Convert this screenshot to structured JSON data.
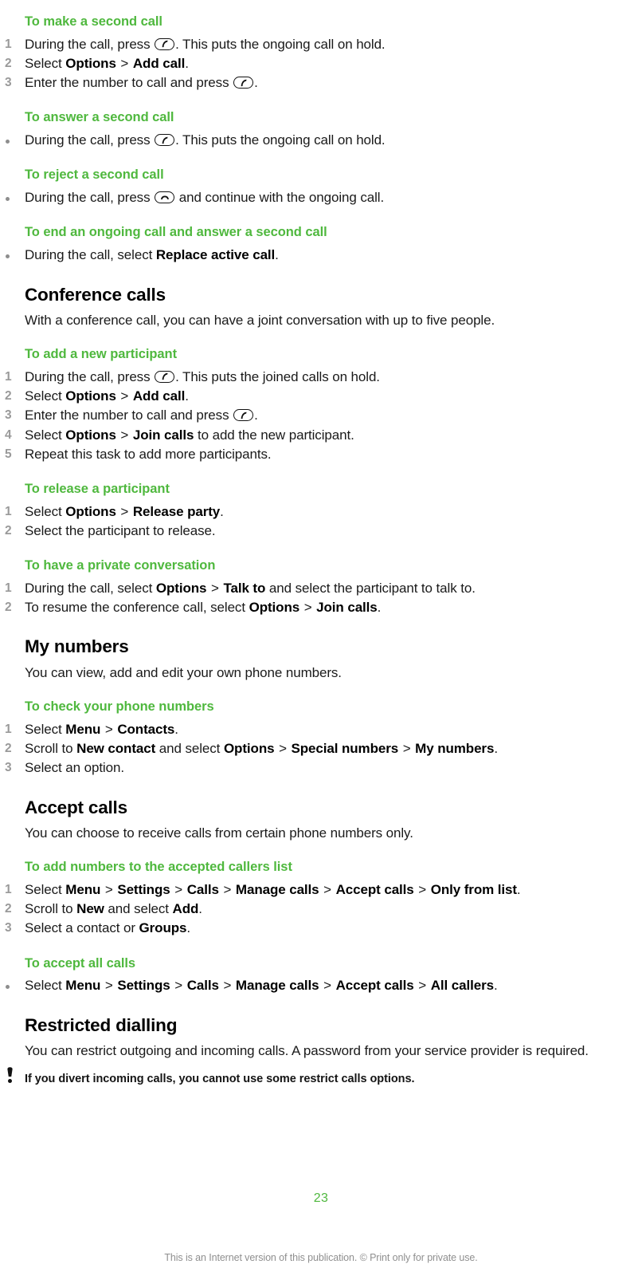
{
  "document": {
    "page_number": "23",
    "footer_note": "This is an Internet version of this publication. © Print only for private use.",
    "accent_green": "#4fb83e",
    "marker_gray": "#9a9a9a",
    "footer_gray": "#8f8f8f"
  },
  "blocks": [
    {
      "type": "task",
      "heading": "To make a second call",
      "list_style": "ordered",
      "items": [
        {
          "marker": "1",
          "segments": [
            {
              "t": "During the call, press "
            },
            {
              "icon": "call-key-icon"
            },
            {
              "t": ". This puts the ongoing call on hold."
            }
          ]
        },
        {
          "marker": "2",
          "segments": [
            {
              "t": "Select "
            },
            {
              "t": "Options",
              "bold": true
            },
            {
              "t": " > ",
              "gt": true
            },
            {
              "t": "Add call",
              "bold": true
            },
            {
              "t": "."
            }
          ]
        },
        {
          "marker": "3",
          "segments": [
            {
              "t": "Enter the number to call and press "
            },
            {
              "icon": "call-key-icon"
            },
            {
              "t": "."
            }
          ]
        }
      ]
    },
    {
      "type": "task",
      "heading": "To answer a second call",
      "list_style": "bullet",
      "items": [
        {
          "marker": "•",
          "segments": [
            {
              "t": "During the call, press "
            },
            {
              "icon": "call-key-icon"
            },
            {
              "t": ". This puts the ongoing call on hold."
            }
          ]
        }
      ]
    },
    {
      "type": "task",
      "heading": "To reject a second call",
      "list_style": "bullet",
      "items": [
        {
          "marker": "•",
          "segments": [
            {
              "t": "During the call, press "
            },
            {
              "icon": "end-call-key-icon"
            },
            {
              "t": " and continue with the ongoing call."
            }
          ]
        }
      ]
    },
    {
      "type": "task",
      "heading": "To end an ongoing call and answer a second call",
      "list_style": "bullet",
      "items": [
        {
          "marker": "•",
          "segments": [
            {
              "t": "During the call, select "
            },
            {
              "t": "Replace active call",
              "bold": true
            },
            {
              "t": "."
            }
          ]
        }
      ]
    },
    {
      "type": "section",
      "heading": "Conference calls",
      "paragraph": "With a conference call, you can have a joint conversation with up to five people."
    },
    {
      "type": "task",
      "heading": "To add a new participant",
      "list_style": "ordered",
      "items": [
        {
          "marker": "1",
          "segments": [
            {
              "t": "During the call, press "
            },
            {
              "icon": "call-key-icon"
            },
            {
              "t": ". This puts the joined calls on hold."
            }
          ]
        },
        {
          "marker": "2",
          "segments": [
            {
              "t": "Select "
            },
            {
              "t": "Options",
              "bold": true
            },
            {
              "t": " > ",
              "gt": true
            },
            {
              "t": "Add call",
              "bold": true
            },
            {
              "t": "."
            }
          ]
        },
        {
          "marker": "3",
          "segments": [
            {
              "t": "Enter the number to call and press "
            },
            {
              "icon": "call-key-icon"
            },
            {
              "t": "."
            }
          ]
        },
        {
          "marker": "4",
          "segments": [
            {
              "t": "Select "
            },
            {
              "t": "Options",
              "bold": true
            },
            {
              "t": " > ",
              "gt": true
            },
            {
              "t": "Join calls",
              "bold": true
            },
            {
              "t": " to add the new participant."
            }
          ]
        },
        {
          "marker": "5",
          "segments": [
            {
              "t": "Repeat this task to add more participants."
            }
          ]
        }
      ]
    },
    {
      "type": "task",
      "heading": "To release a participant",
      "list_style": "ordered",
      "items": [
        {
          "marker": "1",
          "segments": [
            {
              "t": "Select "
            },
            {
              "t": "Options",
              "bold": true
            },
            {
              "t": " > ",
              "gt": true
            },
            {
              "t": "Release party",
              "bold": true
            },
            {
              "t": "."
            }
          ]
        },
        {
          "marker": "2",
          "segments": [
            {
              "t": "Select the participant to release."
            }
          ]
        }
      ]
    },
    {
      "type": "task",
      "heading": "To have a private conversation",
      "list_style": "ordered",
      "items": [
        {
          "marker": "1",
          "segments": [
            {
              "t": "During the call, select "
            },
            {
              "t": "Options",
              "bold": true
            },
            {
              "t": " > ",
              "gt": true
            },
            {
              "t": "Talk to",
              "bold": true
            },
            {
              "t": " and select the participant to talk to."
            }
          ]
        },
        {
          "marker": "2",
          "segments": [
            {
              "t": "To resume the conference call, select "
            },
            {
              "t": "Options",
              "bold": true
            },
            {
              "t": " > ",
              "gt": true
            },
            {
              "t": "Join calls",
              "bold": true
            },
            {
              "t": "."
            }
          ]
        }
      ]
    },
    {
      "type": "section",
      "heading": "My numbers",
      "paragraph": "You can view, add and edit your own phone numbers."
    },
    {
      "type": "task",
      "heading": "To check your phone numbers",
      "list_style": "ordered",
      "items": [
        {
          "marker": "1",
          "segments": [
            {
              "t": "Select "
            },
            {
              "t": "Menu",
              "bold": true
            },
            {
              "t": " > ",
              "gt": true
            },
            {
              "t": "Contacts",
              "bold": true
            },
            {
              "t": "."
            }
          ]
        },
        {
          "marker": "2",
          "segments": [
            {
              "t": "Scroll to "
            },
            {
              "t": "New contact",
              "bold": true
            },
            {
              "t": " and select "
            },
            {
              "t": "Options",
              "bold": true
            },
            {
              "t": " > ",
              "gt": true
            },
            {
              "t": "Special numbers",
              "bold": true
            },
            {
              "t": " > ",
              "gt": true
            },
            {
              "t": "My numbers",
              "bold": true
            },
            {
              "t": "."
            }
          ]
        },
        {
          "marker": "3",
          "segments": [
            {
              "t": "Select an option."
            }
          ]
        }
      ]
    },
    {
      "type": "section",
      "heading": "Accept calls",
      "paragraph": "You can choose to receive calls from certain phone numbers only."
    },
    {
      "type": "task",
      "heading": "To add numbers to the accepted callers list",
      "list_style": "ordered",
      "items": [
        {
          "marker": "1",
          "segments": [
            {
              "t": "Select "
            },
            {
              "t": "Menu",
              "bold": true
            },
            {
              "t": " > ",
              "gt": true
            },
            {
              "t": "Settings",
              "bold": true
            },
            {
              "t": " > ",
              "gt": true
            },
            {
              "t": "Calls",
              "bold": true
            },
            {
              "t": " > ",
              "gt": true
            },
            {
              "t": "Manage calls",
              "bold": true
            },
            {
              "t": " > ",
              "gt": true
            },
            {
              "t": "Accept calls",
              "bold": true
            },
            {
              "t": " > ",
              "gt": true
            },
            {
              "t": "Only from list",
              "bold": true
            },
            {
              "t": "."
            }
          ]
        },
        {
          "marker": "2",
          "segments": [
            {
              "t": "Scroll to "
            },
            {
              "t": "New",
              "bold": true
            },
            {
              "t": " and select "
            },
            {
              "t": "Add",
              "bold": true
            },
            {
              "t": "."
            }
          ]
        },
        {
          "marker": "3",
          "segments": [
            {
              "t": "Select a contact or "
            },
            {
              "t": "Groups",
              "bold": true
            },
            {
              "t": "."
            }
          ]
        }
      ]
    },
    {
      "type": "task",
      "heading": "To accept all calls",
      "list_style": "bullet",
      "items": [
        {
          "marker": "•",
          "segments": [
            {
              "t": "Select "
            },
            {
              "t": "Menu",
              "bold": true
            },
            {
              "t": " > ",
              "gt": true
            },
            {
              "t": "Settings",
              "bold": true
            },
            {
              "t": " > ",
              "gt": true
            },
            {
              "t": "Calls",
              "bold": true
            },
            {
              "t": " > ",
              "gt": true
            },
            {
              "t": "Manage calls",
              "bold": true
            },
            {
              "t": " > ",
              "gt": true
            },
            {
              "t": "Accept calls",
              "bold": true
            },
            {
              "t": " > ",
              "gt": true
            },
            {
              "t": "All callers",
              "bold": true
            },
            {
              "t": "."
            }
          ]
        }
      ]
    },
    {
      "type": "section",
      "heading": "Restricted dialling",
      "paragraph": "You can restrict outgoing and incoming calls. A password from your service provider is required."
    },
    {
      "type": "note",
      "icon": "exclamation-icon",
      "text": "If you divert incoming calls, you cannot use some restrict calls options."
    }
  ]
}
